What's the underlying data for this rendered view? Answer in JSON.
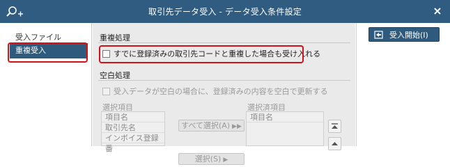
{
  "window": {
    "title": "取引先データ受入 - データ受入条件設定",
    "close_glyph": "×"
  },
  "sidebar": {
    "items": [
      {
        "label": "受入ファイル",
        "selected": false
      },
      {
        "label": "重複受入",
        "selected": true
      }
    ]
  },
  "main": {
    "duplicate_section": {
      "title": "重複処理",
      "checkbox_label": "すでに登録済みの取引先コードと重複した場合も受け入れる",
      "checked": false
    },
    "blank_section": {
      "title": "空白処理",
      "checkbox_label": "受入データが空白の場合に、登録済みの内容を空白で更新する",
      "checked": false,
      "disabled": true
    },
    "select_items": {
      "label": "選択項目",
      "items": [
        "項目名",
        "取引先名",
        "インボイス登録番"
      ]
    },
    "selected_items": {
      "label": "選択済項目",
      "items": [
        "項目名"
      ]
    },
    "buttons": {
      "select_all": "すべて選択(A)",
      "select": "選択(S)"
    }
  },
  "right_panel": {
    "start_button": "受入開始(I)"
  },
  "colors": {
    "titlebar": "#2f5c80",
    "selected": "#2e5a7e",
    "highlight": "#d0121b",
    "panel": "#eaeaea"
  }
}
